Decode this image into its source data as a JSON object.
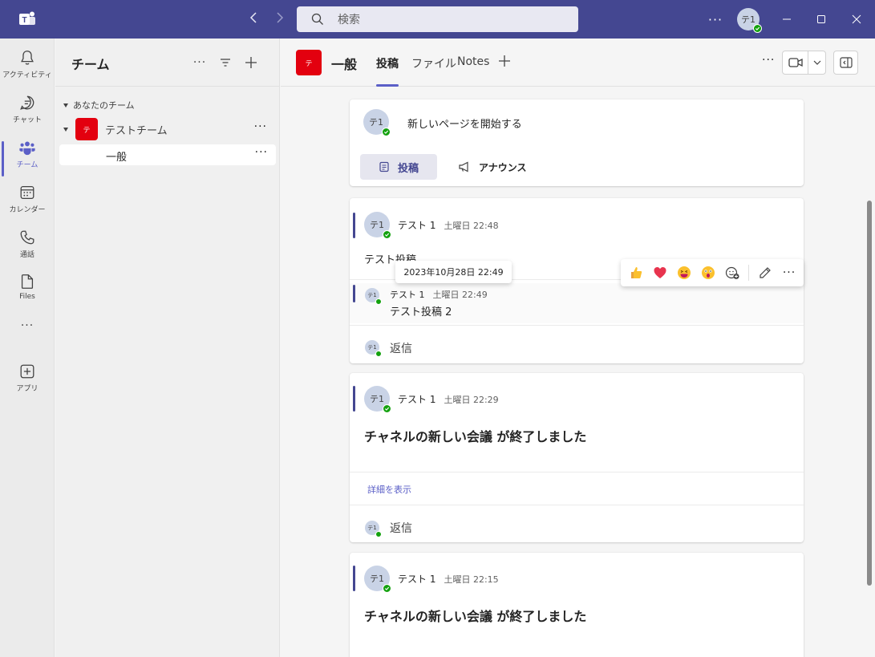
{
  "titlebar": {
    "search_placeholder": "検索",
    "avatar_initials": "テ1"
  },
  "rail": {
    "items": [
      {
        "label": "アクティビティ"
      },
      {
        "label": "チャット"
      },
      {
        "label": "チーム"
      },
      {
        "label": "カレンダー"
      },
      {
        "label": "通話"
      },
      {
        "label": "Files"
      },
      {
        "label": "アプリ"
      }
    ]
  },
  "teampane": {
    "title": "チーム",
    "section": "あなたのチーム",
    "team_icon": "テ",
    "team_name": "テストチーム",
    "channel_name": "一般"
  },
  "channel_header": {
    "icon_text": "テ",
    "name": "一般",
    "tabs": [
      {
        "label": "投稿"
      },
      {
        "label": "ファイル"
      },
      {
        "label": "Notes"
      }
    ]
  },
  "new_post": {
    "avatar": "テ1",
    "prompt": "新しいページを開始する",
    "post_label": "投稿",
    "announce_label": "アナウンス"
  },
  "threads": [
    {
      "avatar": "テ1",
      "author": "テスト 1",
      "time": "土曜日 22:48",
      "text": "テスト投稿",
      "tooltip": "2023年10月28日 22:49",
      "reply": {
        "avatar": "テ1",
        "author": "テスト 1",
        "time": "土曜日 22:49",
        "text": "テスト投稿 2"
      },
      "reply_avatar": "テ1",
      "reply_label": "返信"
    },
    {
      "avatar": "テ1",
      "author": "テスト 1",
      "time": "土曜日 22:29",
      "text": "チャネルの新しい会議 が終了しました",
      "details": "詳細を表示",
      "reply_avatar": "テ1",
      "reply_label": "返信"
    },
    {
      "avatar": "テ1",
      "author": "テスト 1",
      "time": "土曜日 22:15",
      "text": "チャネルの新しい会議 が終了しました"
    }
  ],
  "colors": {
    "brand": "#444791",
    "accent": "#5b5fc7",
    "presence": "#13a10e",
    "team_red": "#e3000f"
  },
  "icons": [
    "teams-logo-icon",
    "back-arrow-icon",
    "forward-arrow-icon",
    "search-icon",
    "more-icon",
    "minimize-icon",
    "maximize-icon",
    "close-icon",
    "bell-icon",
    "chat-icon",
    "teams-icon",
    "calendar-icon",
    "phone-icon",
    "file-icon",
    "add-app-icon",
    "filter-icon",
    "plus-icon",
    "video-icon",
    "chevron-down-icon",
    "panel-icon",
    "post-icon",
    "megaphone-icon",
    "thumbs-up-icon",
    "heart-icon",
    "laugh-icon",
    "surprised-icon",
    "add-reaction-icon",
    "edit-icon"
  ]
}
